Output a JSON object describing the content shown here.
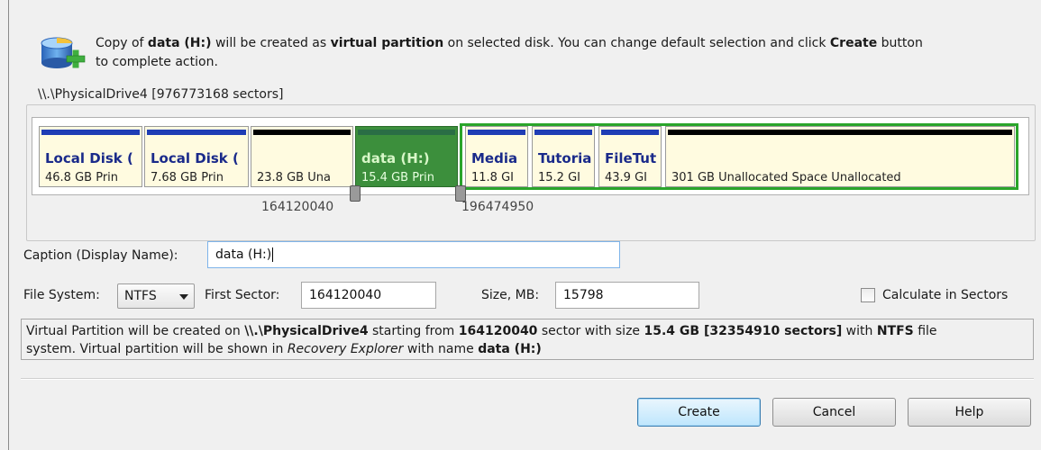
{
  "header": {
    "msg_1": "Copy of ",
    "source_name": "data (H:)",
    "msg_2": " will be created as ",
    "target_type": "virtual partition",
    "msg_3": " on selected disk. You can change default selection and click ",
    "action_name": "Create",
    "msg_4": " button",
    "msg_5": "to complete action.",
    "icon": "add-virtual-partition-icon"
  },
  "disk": {
    "title": "\\\\.\\PhysicalDrive4 [976773168 sectors]",
    "partitions": [
      {
        "title": "Local Disk (",
        "sub": "46.8 GB Prin"
      },
      {
        "title": "Local Disk (",
        "sub": "7.68 GB Prin"
      },
      {
        "title": "",
        "sub": "23.8 GB Una"
      },
      {
        "title": "data (H:)",
        "sub": "15.4 GB Prin"
      },
      {
        "title": "Media",
        "sub": "11.8 GI"
      },
      {
        "title": "Tutoria",
        "sub": "15.2 GI"
      },
      {
        "title": "FileTut",
        "sub": "43.9 GI"
      },
      {
        "title": "",
        "sub": "301 GB Unallocated Space Unallocated"
      }
    ],
    "start_sector": "164120040",
    "end_sector": "196474950"
  },
  "form": {
    "caption_label": "Caption (Display Name):",
    "caption_value": "data (H:)",
    "fs_label": "File System:",
    "fs_value": "NTFS",
    "first_sector_label": "First Sector:",
    "first_sector_value": "164120040",
    "size_label": "Size, MB:",
    "size_value": "15798",
    "calc_label": "Calculate in Sectors"
  },
  "info": {
    "t1": "Virtual Partition will be created on ",
    "drive": "\\\\.\\PhysicalDrive4",
    "t2": " starting from ",
    "sector": "164120040",
    "t3": " sector with size ",
    "size": "15.4 GB [32354910 sectors]",
    "t4": " with ",
    "fs": "NTFS",
    "t5": " file",
    "t6": "system. Virtual partition will be shown in ",
    "explorer": "Recovery Explorer",
    "t7": " with name ",
    "name": "data (H:)"
  },
  "buttons": {
    "create": "Create",
    "cancel": "Cancel",
    "help": "Help"
  }
}
